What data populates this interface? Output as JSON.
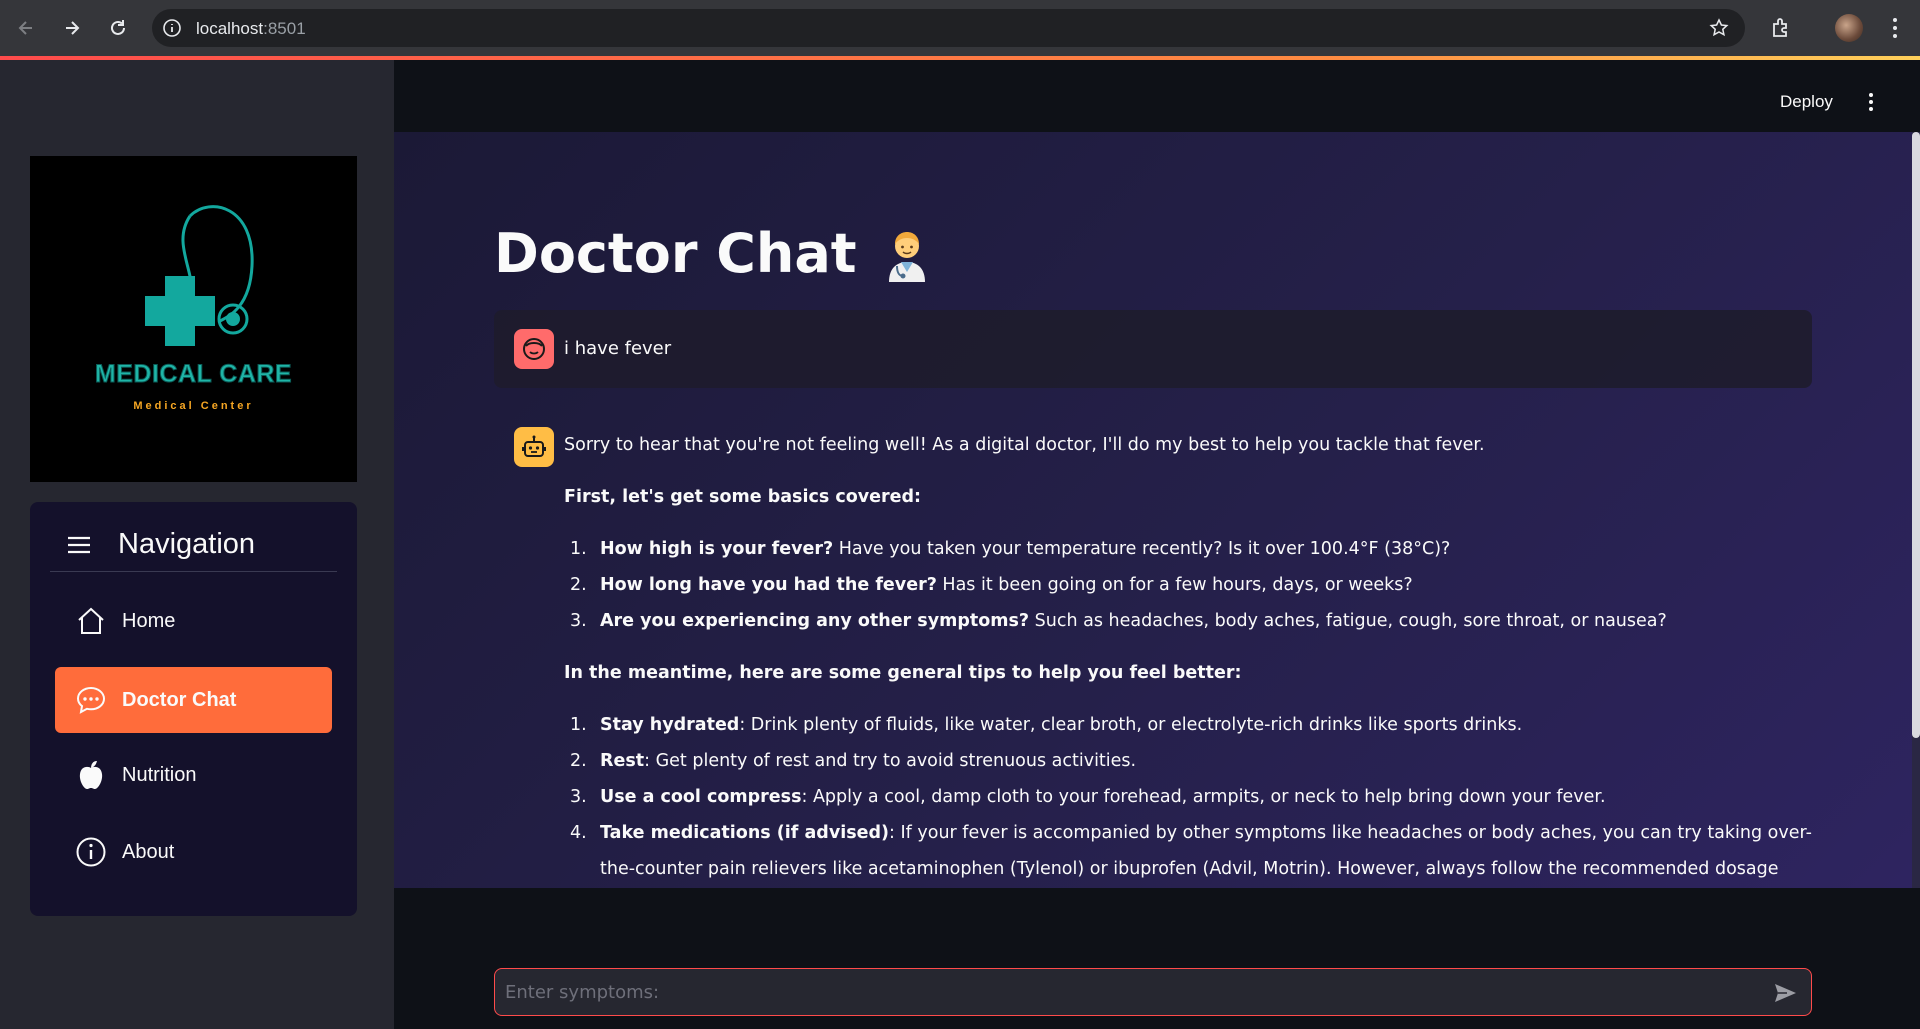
{
  "browser": {
    "url_host": "localhost",
    "url_port": ":8501"
  },
  "sidebar": {
    "logo": {
      "title": "MEDICAL CARE",
      "subtitle": "Medical Center"
    },
    "nav_title": "Navigation",
    "items": [
      {
        "label": "Home",
        "icon": "house-icon",
        "active": false
      },
      {
        "label": "Doctor Chat",
        "icon": "chat-bubble-icon",
        "active": true
      },
      {
        "label": "Nutrition",
        "icon": "apple-icon",
        "active": false
      },
      {
        "label": "About",
        "icon": "info-circle-icon",
        "active": false
      }
    ]
  },
  "header": {
    "deploy_label": "Deploy"
  },
  "main": {
    "title": "Doctor Chat",
    "title_emoji": "health-worker-emoji",
    "user_message": "i have fever",
    "bot": {
      "intro": "Sorry to hear that you're not feeling well! As a digital doctor, I'll do my best to help you tackle that fever.",
      "basics_heading": "First, let's get some basics covered:",
      "questions": [
        {
          "num": "1.",
          "bold": "How high is your fever?",
          "text": " Have you taken your temperature recently? Is it over 100.4°F (38°C)?"
        },
        {
          "num": "2.",
          "bold": "How long have you had the fever?",
          "text": " Has it been going on for a few hours, days, or weeks?"
        },
        {
          "num": "3.",
          "bold": "Are you experiencing any other symptoms?",
          "text": " Such as headaches, body aches, fatigue, cough, sore throat, or nausea?"
        }
      ],
      "tips_heading": "In the meantime, here are some general tips to help you feel better:",
      "tips": [
        {
          "num": "1.",
          "bold": "Stay hydrated",
          "text": ": Drink plenty of fluids, like water, clear broth, or electrolyte-rich drinks like sports drinks."
        },
        {
          "num": "2.",
          "bold": "Rest",
          "text": ": Get plenty of rest and try to avoid strenuous activities."
        },
        {
          "num": "3.",
          "bold": "Use a cool compress",
          "text": ": Apply a cool, damp cloth to your forehead, armpits, or neck to help bring down your fever."
        },
        {
          "num": "4.",
          "bold": "Take medications (if advised)",
          "text": ": If your fever is accompanied by other symptoms like headaches or body aches, you can try taking over-the-counter pain relievers like acetaminophen (Tylenol) or ibuprofen (Advil, Motrin). However, always follow the recommended dosage and consult with a"
        }
      ]
    },
    "input": {
      "placeholder": "Enter symptoms:",
      "value": ""
    }
  },
  "colors": {
    "accent": "#ff6c3b",
    "input_border": "#ff4b4b",
    "user_avatar": "#ff6b6b",
    "bot_avatar": "#ffbd45",
    "logo_teal": "#1fb5a7",
    "logo_orange": "#f6a623"
  }
}
